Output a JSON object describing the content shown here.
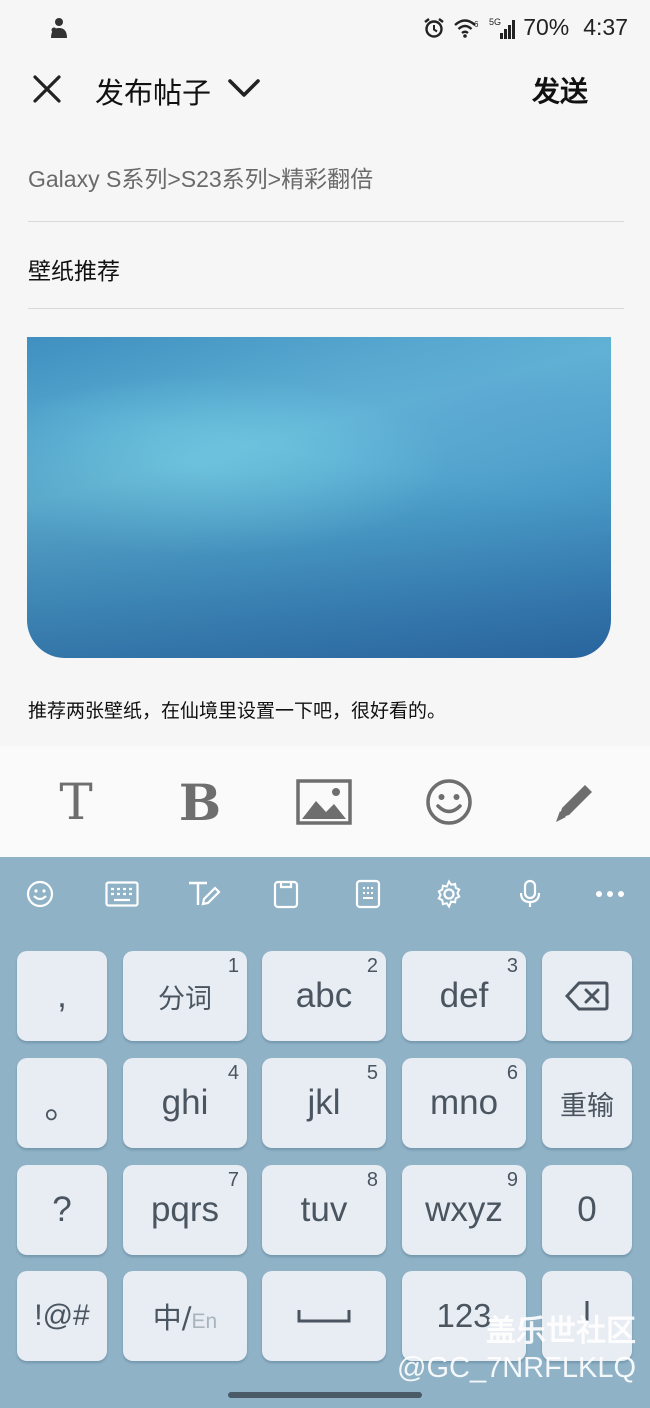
{
  "status": {
    "battery": "70%",
    "time": "4:37",
    "network": "5G"
  },
  "header": {
    "title": "发布帖子",
    "send_label": "发送"
  },
  "form": {
    "breadcrumb": "Galaxy S系列>S23系列>精彩翻倍",
    "post_title": "壁纸推荐",
    "body": "推荐两张壁纸，在仙境里设置一下吧，很好看的。"
  },
  "format_toolbar": {
    "text_style": "T",
    "bold": "B"
  },
  "keyboard": {
    "rows": [
      [
        {
          "label": ",",
          "num": ""
        },
        {
          "label": "分词",
          "num": "1"
        },
        {
          "label": "abc",
          "num": "2"
        },
        {
          "label": "def",
          "num": "3"
        },
        {
          "label": "",
          "num": ""
        }
      ],
      [
        {
          "label": "。",
          "num": ""
        },
        {
          "label": "ghi",
          "num": "4"
        },
        {
          "label": "jkl",
          "num": "5"
        },
        {
          "label": "mno",
          "num": "6"
        },
        {
          "label": "重输",
          "num": ""
        }
      ],
      [
        {
          "label": "?",
          "num": ""
        },
        {
          "label": "pqrs",
          "num": "7"
        },
        {
          "label": "tuv",
          "num": "8"
        },
        {
          "label": "wxyz",
          "num": "9"
        },
        {
          "label": "0",
          "num": ""
        }
      ],
      [
        {
          "label": "!@#",
          "num": ""
        },
        {
          "label": "中/",
          "num": ""
        },
        {
          "label": "",
          "num": ""
        },
        {
          "label": "123",
          "num": ""
        },
        {
          "label": "",
          "num": ""
        }
      ]
    ],
    "lang_sub": "En"
  },
  "watermark": {
    "line1": "盖乐世社区",
    "line2": "@GC_7NRFLKLQ"
  },
  "colors": {
    "keyboard_bg": "#8fb2c7",
    "key_bg": "#e8ecf3",
    "key_text": "#4a5560"
  }
}
